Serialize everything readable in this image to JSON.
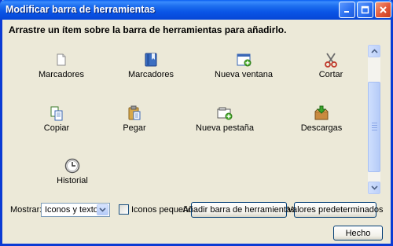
{
  "window": {
    "title": "Modificar barra de herramientas",
    "controls": [
      "minimize-icon",
      "maximize-icon",
      "close-icon"
    ]
  },
  "heading": "Arrastre un ítem sobre la barra de herramientas para añadirlo.",
  "items": [
    {
      "label": "Marcadores",
      "icon": "bookmark-page-icon"
    },
    {
      "label": "Marcadores",
      "icon": "bookmarks-book-icon"
    },
    {
      "label": "Nueva ventana",
      "icon": "new-window-icon"
    },
    {
      "label": "Cortar",
      "icon": "scissors-icon"
    },
    {
      "label": "Copiar",
      "icon": "copy-icon"
    },
    {
      "label": "Pegar",
      "icon": "paste-icon"
    },
    {
      "label": "Nueva pestaña",
      "icon": "new-tab-icon"
    },
    {
      "label": "Descargas",
      "icon": "downloads-icon"
    },
    {
      "label": "Historial",
      "icon": "history-clock-icon"
    }
  ],
  "footer": {
    "show_label": "Mostrar:",
    "show_value": "Iconos y texto",
    "small_icons_label": "Iconos pequeños",
    "small_icons_checked": false,
    "add_toolbar_button": "Añadir barra de herramientas",
    "defaults_button": "Valores predeterminados",
    "done_button": "Hecho"
  },
  "colors": {
    "titlebar": "#0a55e6",
    "dialog_bg": "#ece9d8",
    "button_border": "#003c74"
  }
}
